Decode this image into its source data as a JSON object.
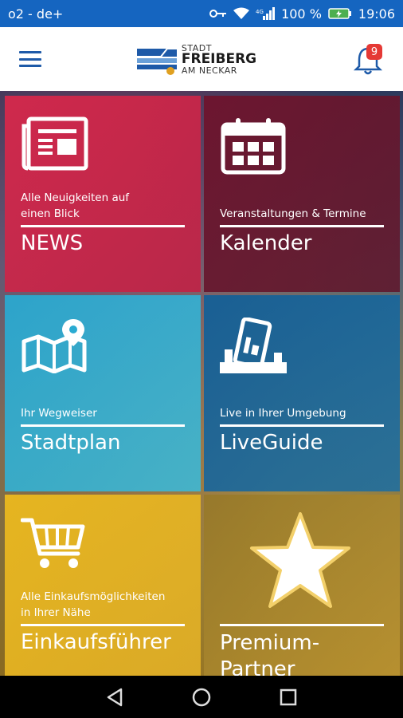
{
  "statusbar": {
    "carrier": "o2 - de+",
    "battery_percent": "100 %",
    "time": "19:06"
  },
  "appbar": {
    "logo_line1": "STADT",
    "logo_line2": "FREIBERG",
    "logo_line3": "AM NECKAR",
    "notification_count": "9"
  },
  "tiles": [
    {
      "subtitle_1": "Alle Neuigkeiten auf",
      "subtitle_2": "einen Blick",
      "title": "NEWS",
      "icon": "newspaper-icon"
    },
    {
      "subtitle_1": "Veranstaltungen & Termine",
      "title": "Kalender",
      "icon": "calendar-icon"
    },
    {
      "subtitle_1": "Ihr Wegweiser",
      "title": "Stadtplan",
      "icon": "map-icon"
    },
    {
      "subtitle_1": "Live in Ihrer Umgebung",
      "title": "LiveGuide",
      "icon": "phone-camera-icon"
    },
    {
      "subtitle_1": "Alle Einkaufsmöglichkeiten",
      "subtitle_2": "in Ihrer Nähe",
      "title": "Einkaufsführer",
      "icon": "shopping-cart-icon"
    },
    {
      "title_1": "Premium-",
      "title_2": "Partner",
      "icon": "star-icon"
    }
  ],
  "colors": {
    "statusbar": "#1565c0",
    "news": "#d6284b",
    "kalender": "#6e142d",
    "stadtplan": "#28aad2",
    "liveguide": "#145f96",
    "einkauf": "#ebb91e",
    "premium": "#967828"
  }
}
